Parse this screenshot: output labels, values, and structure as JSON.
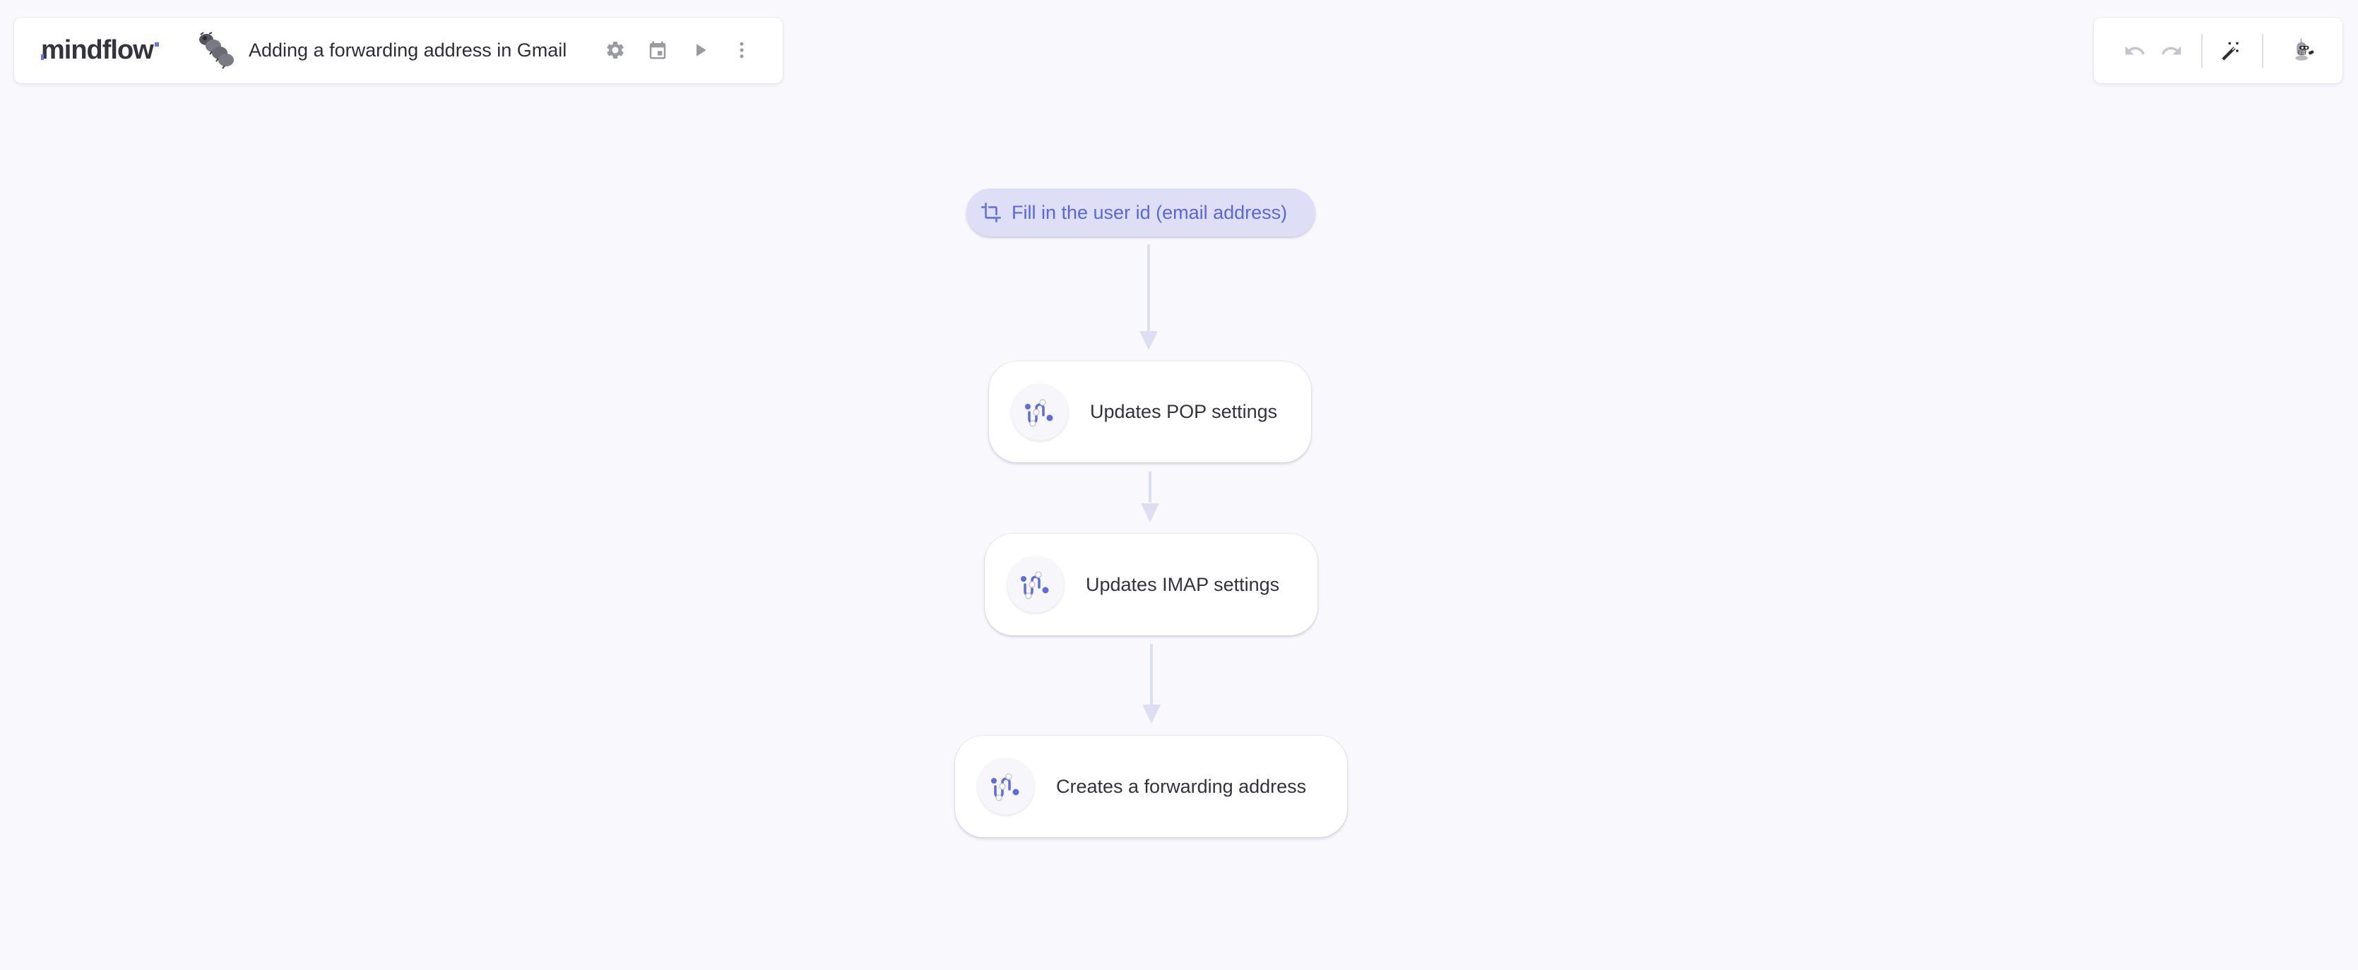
{
  "app": {
    "logo_text": "mindflow",
    "accent_color": "#6c74ee"
  },
  "header": {
    "mascot_icon": "caterpillar-mascot",
    "title": "Adding a forwarding address in Gmail",
    "actions": [
      {
        "name": "settings",
        "icon": "gear-icon"
      },
      {
        "name": "schedule",
        "icon": "calendar-icon"
      },
      {
        "name": "run",
        "icon": "play-icon"
      },
      {
        "name": "more",
        "icon": "more-vertical-icon"
      }
    ]
  },
  "toolbar": {
    "undo_icon": "undo-icon",
    "redo_icon": "redo-icon",
    "magic_icon": "magic-wand-icon",
    "avatar_icon": "robot-avatar"
  },
  "flow": {
    "trigger": {
      "icon": "crop-icon",
      "label": "Fill in the user id (email address)"
    },
    "steps": [
      {
        "icon": "route-icon",
        "label": "Updates POP settings"
      },
      {
        "icon": "route-icon",
        "label": "Updates IMAP settings"
      },
      {
        "icon": "route-icon",
        "label": "Creates a forwarding address"
      }
    ]
  }
}
